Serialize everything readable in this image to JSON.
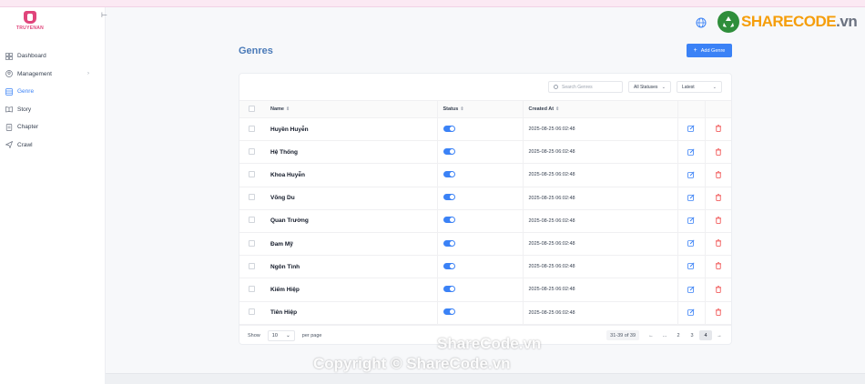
{
  "brand": {
    "logo_text": "TRUYENAN",
    "watermark_name_a": "SHARE",
    "watermark_name_b": "CODE",
    "watermark_suffix": ".vn"
  },
  "sidebar": {
    "collapse_icon": "collapse-icon",
    "items": [
      {
        "label": "Dashboard",
        "icon": "grid-icon",
        "active": false
      },
      {
        "label": "Management",
        "icon": "user-circle-icon",
        "active": false,
        "has_chevron": true
      },
      {
        "label": "Genre",
        "icon": "list-icon",
        "active": true
      },
      {
        "label": "Story",
        "icon": "book-icon",
        "active": false
      },
      {
        "label": "Chapter",
        "icon": "document-icon",
        "active": false
      },
      {
        "label": "Crawl",
        "icon": "send-icon",
        "active": false
      }
    ],
    "chevron": "›"
  },
  "page": {
    "title": "Genres",
    "add_button": "Add Genre"
  },
  "filters": {
    "search_placeholder": "Search Genres",
    "status_value": "All Statuses",
    "sort_value": "Latest"
  },
  "table": {
    "columns": {
      "name": "Name",
      "status": "Status",
      "created": "Created At"
    },
    "rows": [
      {
        "name": "Huyền Huyễn",
        "status": true,
        "created": "2025-08-25 06:02:48"
      },
      {
        "name": "Hệ Thống",
        "status": true,
        "created": "2025-08-25 06:02:48"
      },
      {
        "name": "Khoa Huyễn",
        "status": true,
        "created": "2025-08-25 06:02:48"
      },
      {
        "name": "Võng Du",
        "status": true,
        "created": "2025-08-25 06:02:48"
      },
      {
        "name": "Quan Trường",
        "status": true,
        "created": "2025-08-25 06:02:48"
      },
      {
        "name": "Đam Mỹ",
        "status": true,
        "created": "2025-08-25 06:02:48"
      },
      {
        "name": "Ngôn Tình",
        "status": true,
        "created": "2025-08-25 06:02:48"
      },
      {
        "name": "Kiếm Hiệp",
        "status": true,
        "created": "2025-08-25 06:02:48"
      },
      {
        "name": "Tiên Hiệp",
        "status": true,
        "created": "2025-08-25 06:02:48"
      }
    ]
  },
  "pagination": {
    "show_label": "Show",
    "per_page_value": "10",
    "per_page_label": "per page",
    "range": "31-39 of 39",
    "prev": "←",
    "ellipsis": "...",
    "pages": [
      "2",
      "3",
      "4"
    ],
    "current": "4",
    "next": "→"
  },
  "watermarks": {
    "line1": "ShareCode.vn",
    "line2": "Copyright © ShareCode.vn"
  },
  "colors": {
    "accent": "#3b82f6",
    "title": "#4a7ab8",
    "danger": "#ef4444",
    "logo": "#e0457b"
  }
}
